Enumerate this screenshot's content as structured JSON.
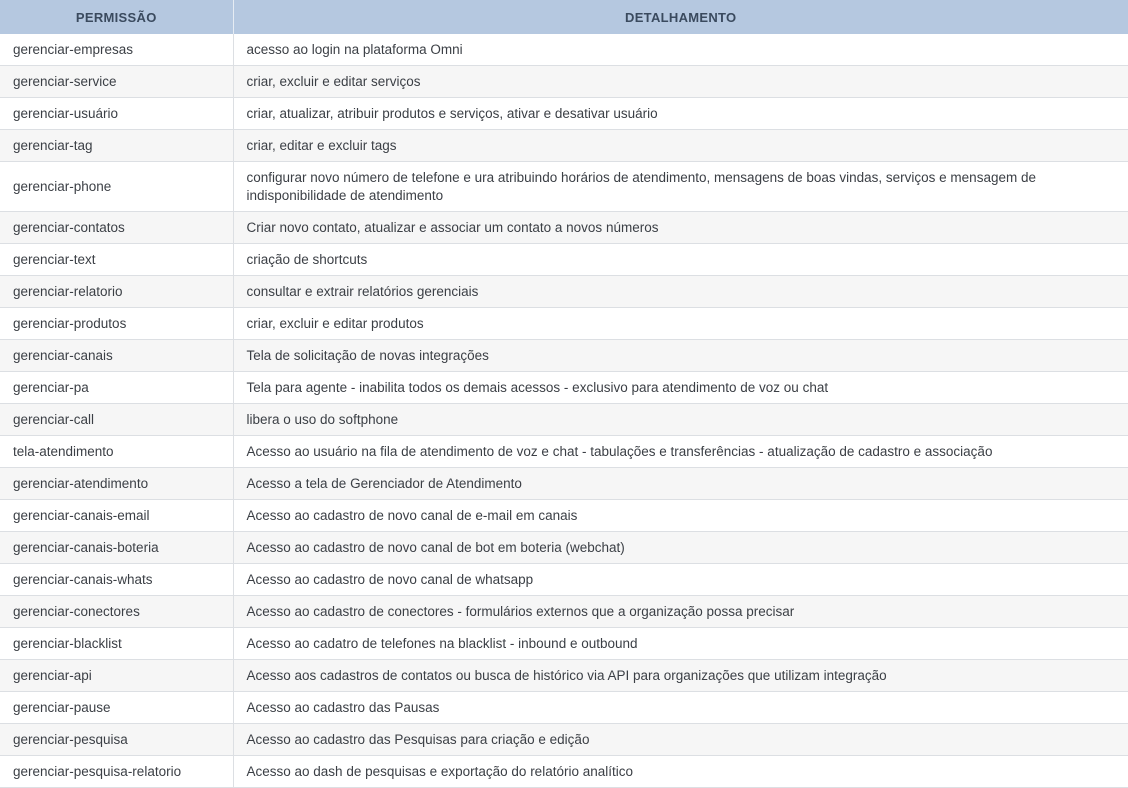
{
  "table": {
    "headers": [
      "PERMISSÃO",
      "DETALHAMENTO"
    ],
    "rows": [
      {
        "permission": "gerenciar-empresas",
        "detail": "acesso ao login na plataforma Omni"
      },
      {
        "permission": "gerenciar-service",
        "detail": "criar, excluir e editar serviços"
      },
      {
        "permission": "gerenciar-usuário",
        "detail": "criar, atualizar, atribuir produtos e serviços, ativar e desativar usuário"
      },
      {
        "permission": "gerenciar-tag",
        "detail": "criar, editar e excluir tags"
      },
      {
        "permission": "gerenciar-phone",
        "detail": "configurar novo número de telefone e ura atribuindo horários de atendimento, mensagens de boas vindas, serviços e mensagem de indisponibilidade de atendimento"
      },
      {
        "permission": "gerenciar-contatos",
        "detail": "Criar novo contato, atualizar e associar um contato a novos números"
      },
      {
        "permission": "gerenciar-text",
        "detail": "criação de shortcuts"
      },
      {
        "permission": "gerenciar-relatorio",
        "detail": "consultar e extrair relatórios gerenciais"
      },
      {
        "permission": "gerenciar-produtos",
        "detail": "criar, excluir e editar produtos"
      },
      {
        "permission": "gerenciar-canais",
        "detail": "Tela de solicitação de novas integrações"
      },
      {
        "permission": "gerenciar-pa",
        "detail": "Tela para agente - inabilita todos os demais acessos - exclusivo para atendimento de voz ou chat"
      },
      {
        "permission": "gerenciar-call",
        "detail": "libera o uso do softphone"
      },
      {
        "permission": "tela-atendimento",
        "detail": "Acesso ao usuário na fila de atendimento de voz e chat - tabulações e transferências - atualização de cadastro e associação"
      },
      {
        "permission": "gerenciar-atendimento",
        "detail": "Acesso a tela de Gerenciador de Atendimento"
      },
      {
        "permission": "gerenciar-canais-email",
        "detail": "Acesso ao cadastro de novo canal de e-mail em canais"
      },
      {
        "permission": "gerenciar-canais-boteria",
        "detail": "Acesso ao cadastro de novo canal de bot em boteria (webchat)"
      },
      {
        "permission": "gerenciar-canais-whats",
        "detail": "Acesso ao cadastro de novo canal de whatsapp"
      },
      {
        "permission": "gerenciar-conectores",
        "detail": "Acesso ao cadastro de conectores - formulários externos que a organização possa precisar"
      },
      {
        "permission": "gerenciar-blacklist",
        "detail": "Acesso ao cadatro de telefones na blacklist - inbound e outbound"
      },
      {
        "permission": "gerenciar-api",
        "detail": "Acesso aos cadastros de contatos ou busca de histórico via API para organizações que utilizam integração"
      },
      {
        "permission": "gerenciar-pause",
        "detail": "Acesso ao cadastro das Pausas"
      },
      {
        "permission": "gerenciar-pesquisa",
        "detail": "Acesso ao cadastro das Pesquisas para criação e edição"
      },
      {
        "permission": "gerenciar-pesquisa-relatorio",
        "detail": "Acesso ao dash de pesquisas e exportação do relatório analítico"
      }
    ]
  }
}
